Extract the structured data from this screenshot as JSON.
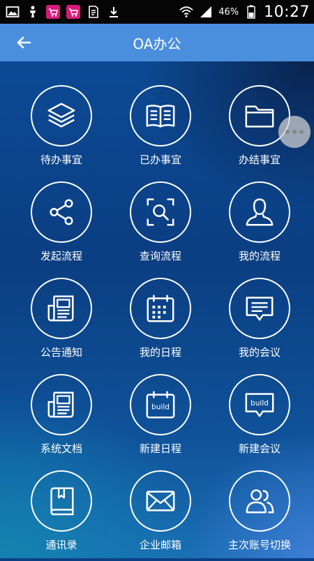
{
  "status_bar": {
    "left_icons": [
      "image-icon",
      "usb-debug-icon",
      "cart-icon",
      "cart-icon",
      "sim-icon",
      "download-icon"
    ],
    "battery": "46%",
    "time": "10:27"
  },
  "header": {
    "title": "OA办公",
    "back_icon": "back-arrow-icon",
    "more_icon": "more-dots-icon"
  },
  "grid": {
    "items": [
      {
        "label": "待办事宜",
        "icon": "layers-icon"
      },
      {
        "label": "已办事宜",
        "icon": "book-icon"
      },
      {
        "label": "办结事宜",
        "icon": "folder-icon"
      },
      {
        "label": "发起流程",
        "icon": "share-icon"
      },
      {
        "label": "查询流程",
        "icon": "scan-search-icon"
      },
      {
        "label": "我的流程",
        "icon": "user-icon"
      },
      {
        "label": "公告通知",
        "icon": "newspaper-icon"
      },
      {
        "label": "我的日程",
        "icon": "calendar-icon"
      },
      {
        "label": "我的会议",
        "icon": "chat-icon"
      },
      {
        "label": "系统文档",
        "icon": "document-icon"
      },
      {
        "label": "新建日程",
        "icon": "build-calendar-icon",
        "badge": "build"
      },
      {
        "label": "新建会议",
        "icon": "build-chat-icon",
        "badge": "build"
      },
      {
        "label": "通讯录",
        "icon": "contacts-book-icon"
      },
      {
        "label": "企业邮箱",
        "icon": "mail-icon"
      },
      {
        "label": "主次账号切换",
        "icon": "users-icon"
      }
    ]
  }
}
